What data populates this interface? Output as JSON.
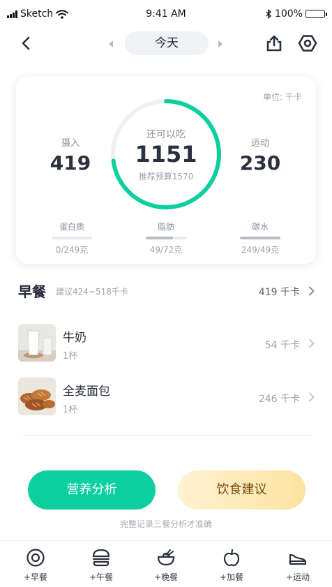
{
  "status_bar": {
    "carrier": "Sketch",
    "time": "9:41 AM",
    "battery": "100%"
  },
  "nav": {
    "date_label": "今天",
    "icons": [
      "back-icon",
      "triangle-left-icon",
      "triangle-right-icon",
      "share-icon",
      "settings-icon"
    ]
  },
  "summary": {
    "unit_label": "单位:  千卡",
    "intake": {
      "label": "摄入",
      "value": "419"
    },
    "remaining": {
      "label": "还可以吃",
      "value": "1151",
      "budget": "推荐预算1570"
    },
    "exercise": {
      "label": "运动",
      "value": "230"
    },
    "ring_progress": 0.73,
    "ring_color": "#0ccf9f",
    "macros": [
      {
        "label": "蛋白质",
        "amount": "0/249克",
        "progress": 0
      },
      {
        "label": "脂肪",
        "amount": "49/72克",
        "progress": 0.68
      },
      {
        "label": "碳水",
        "amount": "249/49克",
        "progress": 1
      }
    ]
  },
  "breakfast": {
    "title": "早餐",
    "hint": "建议424~518千卡",
    "total": "419 千卡",
    "items": [
      {
        "name": "牛奶",
        "qty": "1杯",
        "kcal": "54 千卡",
        "thumb": "milk-photo"
      },
      {
        "name": "全麦面包",
        "qty": "1杯",
        "kcal": "246 千卡",
        "thumb": "bread-photo"
      }
    ]
  },
  "actions": {
    "nutrition": "营养分析",
    "advice": "饮食建议",
    "tip": "完整记录三餐分析才准确"
  },
  "tabbar": {
    "items": [
      {
        "label": "+早餐",
        "icon": "plate-icon"
      },
      {
        "label": "+午餐",
        "icon": "burger-icon"
      },
      {
        "label": "+晚餐",
        "icon": "bowl-icon"
      },
      {
        "label": "+加餐",
        "icon": "apple-icon"
      },
      {
        "label": "+运动",
        "icon": "sneaker-icon"
      }
    ]
  },
  "colors": {
    "accent": "#0ccf9f",
    "advice_text": "#7a4e0e",
    "advice_bg": "#fbe39f"
  }
}
